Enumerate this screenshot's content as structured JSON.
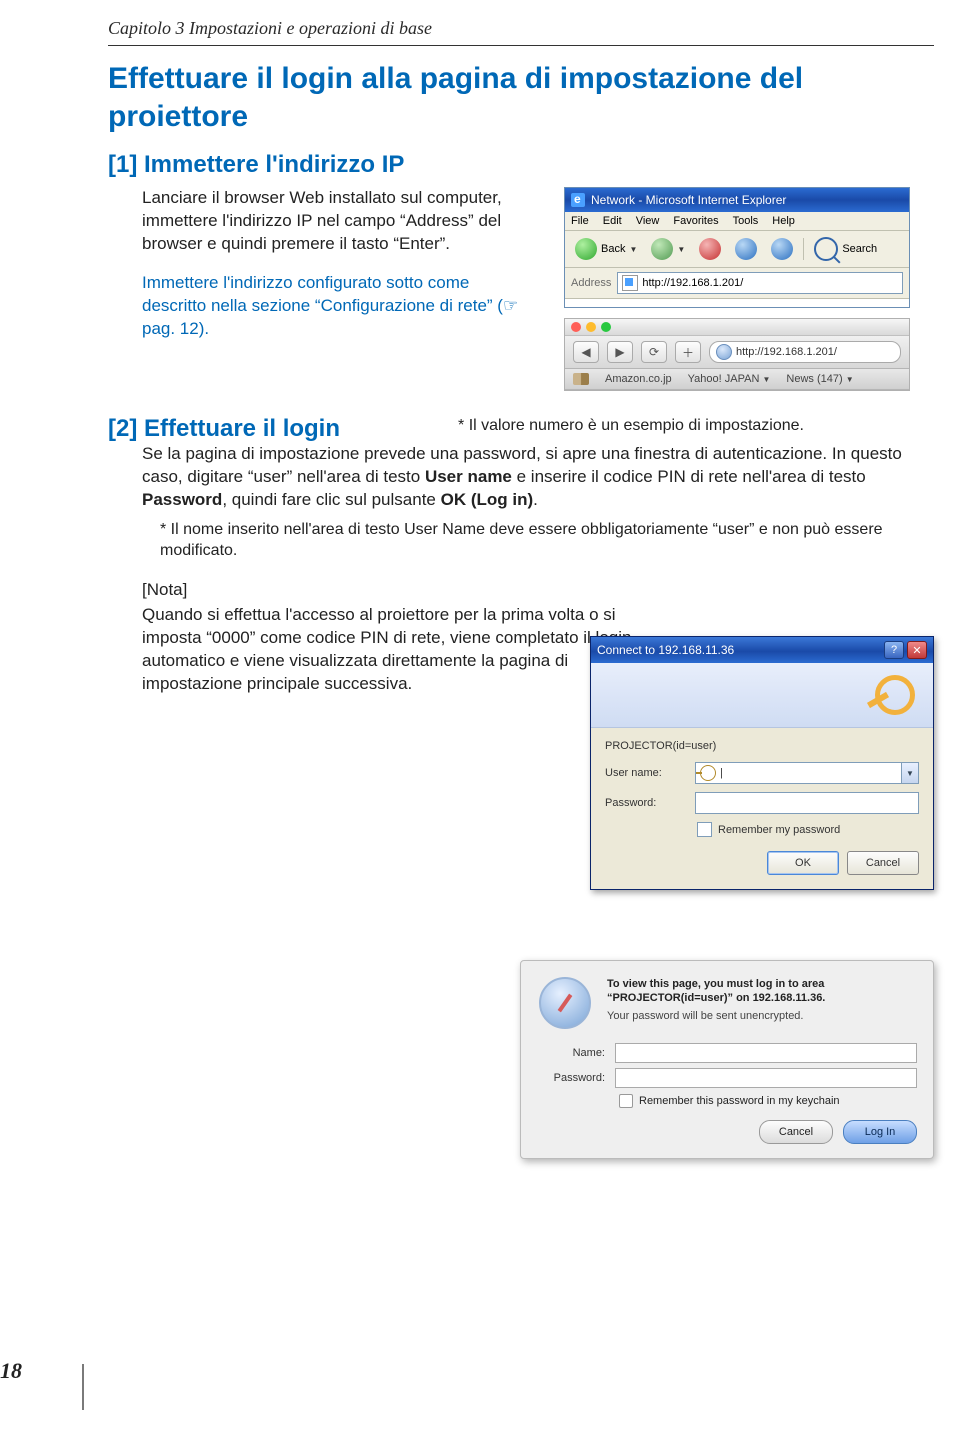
{
  "chapter": "Capitolo 3 Impostazioni e operazioni di base",
  "main_title": "Effettuare il login alla pagina di impostazione del proiettore",
  "sec1": {
    "title": "[1] Immettere l'indirizzo IP",
    "p1": "Lanciare il browser Web installato sul computer, immettere l'indirizzo IP nel campo “Address” del browser e quindi premere il tasto “Enter”.",
    "p2": "Immettere l'indirizzo configurato sotto come descritto nella sezione “Configurazione di rete” (☞ pag. 12)."
  },
  "ie": {
    "title": "Network - Microsoft Internet Explorer",
    "menu": [
      "File",
      "Edit",
      "View",
      "Favorites",
      "Tools",
      "Help"
    ],
    "back": "Back",
    "search": "Search",
    "addr_label": "Address",
    "url": "http://192.168.1.201/"
  },
  "safari": {
    "url": "http://192.168.1.201/",
    "bookmarks": [
      "Amazon.co.jp",
      "Yahoo! JAPAN",
      "News (147)"
    ]
  },
  "sec2_title": "[2] Effettuare il login",
  "sec2_note": "* Il valore numero è un esempio di impostazione.",
  "sec2_p1a": "Se la pagina di impostazione prevede una password, si apre una finestra di autenticazione. In questo caso, digitare “user” nell'area di testo ",
  "sec2_p1b": "User name",
  "sec2_p1c": " e inserire il codice PIN di rete nell'area di testo ",
  "sec2_p1d": "Password",
  "sec2_p1e": ", quindi fare clic sul pulsante ",
  "sec2_p1f": "OK (Log in)",
  "sec2_p1g": ".",
  "sec2_small": "* Il nome inserito nell'area di testo User Name deve essere obbligatoriamente “user” e non può essere modificato.",
  "note_label": "[Nota]",
  "note_body": "Quando si effettua l'accesso al proiettore per la prima volta o si imposta “0000” come codice PIN di rete, viene completato il login automatico e viene visualizzata direttamente la pagina di impostazione principale successiva.",
  "win": {
    "title": "Connect to 192.168.11.36",
    "realm": "PROJECTOR(id=user)",
    "user_label": "User name:",
    "pass_label": "Password:",
    "usercursor": "|",
    "remember": "Remember my password",
    "ok": "OK",
    "cancel": "Cancel"
  },
  "mac": {
    "line1": "To view this page, you must log in to area “PROJECTOR(id=user)” on 192.168.11.36.",
    "line2": "Your password will be sent unencrypted.",
    "name_label": "Name:",
    "pass_label": "Password:",
    "remember": "Remember this password in my keychain",
    "cancel": "Cancel",
    "login": "Log In"
  },
  "page_num": "18"
}
